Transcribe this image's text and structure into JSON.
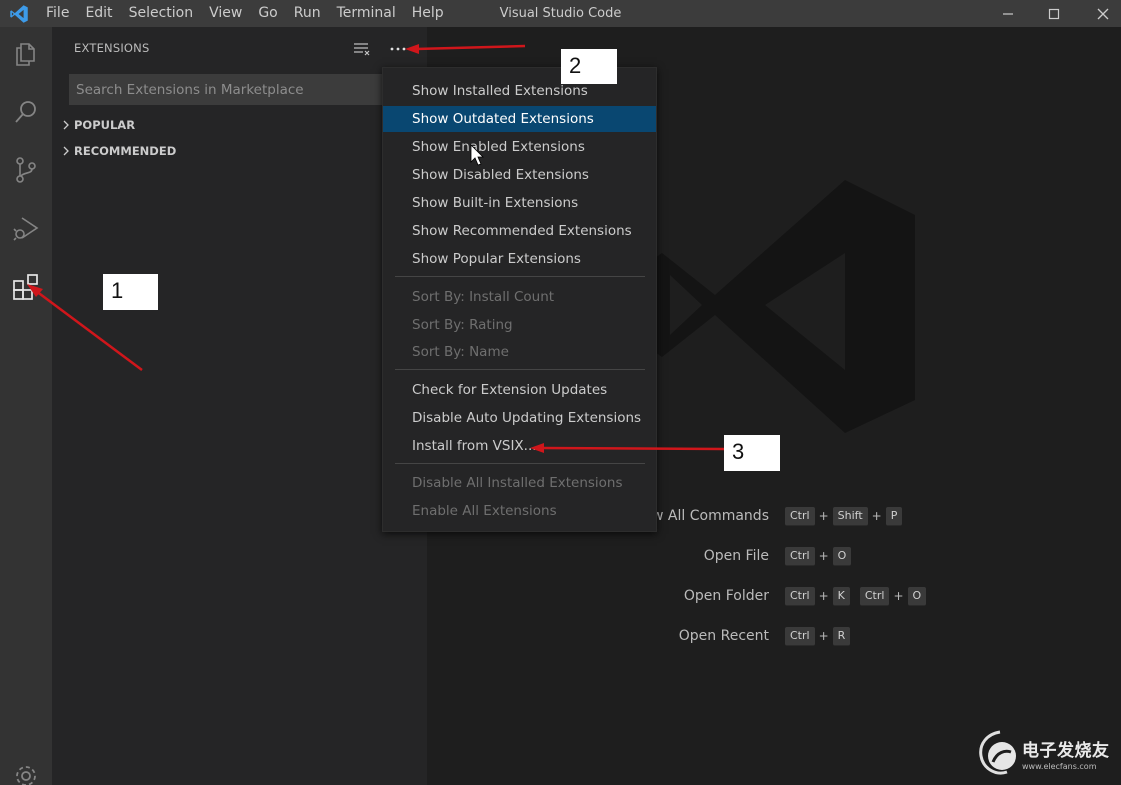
{
  "titlebar": {
    "menu": [
      "File",
      "Edit",
      "Selection",
      "View",
      "Go",
      "Run",
      "Terminal",
      "Help"
    ],
    "title": "Visual Studio Code"
  },
  "activitybar": {
    "icons": [
      "explorer-icon",
      "search-icon",
      "source-control-icon",
      "run-debug-icon",
      "extensions-icon",
      "settings-gear-icon"
    ]
  },
  "sidebar": {
    "title": "EXTENSIONS",
    "search_placeholder": "Search Extensions in Marketplace",
    "sections": [
      "POPULAR",
      "RECOMMENDED"
    ]
  },
  "context_menu": {
    "group1": [
      "Show Installed Extensions",
      "Show Outdated Extensions",
      "Show Enabled Extensions",
      "Show Disabled Extensions",
      "Show Built-in Extensions",
      "Show Recommended Extensions",
      "Show Popular Extensions"
    ],
    "group2": [
      "Sort By: Install Count",
      "Sort By: Rating",
      "Sort By: Name"
    ],
    "group3": [
      "Check for Extension Updates",
      "Disable Auto Updating Extensions",
      "Install from VSIX..."
    ],
    "group4": [
      "Disable All Installed Extensions",
      "Enable All Extensions"
    ],
    "highlighted": "Show Outdated Extensions"
  },
  "shortcuts": [
    {
      "label": "w All Commands",
      "keys": [
        "Ctrl",
        "+",
        "Shift",
        "+",
        "P"
      ]
    },
    {
      "label": "Open File",
      "keys": [
        "Ctrl",
        "+",
        "O"
      ]
    },
    {
      "label": "Open Folder",
      "keys": [
        "Ctrl",
        "+",
        "K",
        " ",
        "Ctrl",
        "+",
        "O"
      ]
    },
    {
      "label": "Open Recent",
      "keys": [
        "Ctrl",
        "+",
        "R"
      ]
    }
  ],
  "annotations": [
    "1",
    "2",
    "3"
  ],
  "brand": {
    "name": "电子发烧友",
    "url": "www.elecfans.com"
  },
  "colors": {
    "menu_highlight": "#094771",
    "annotation_arrow": "#d0161b",
    "vscode_blue": "#3d9be9"
  }
}
